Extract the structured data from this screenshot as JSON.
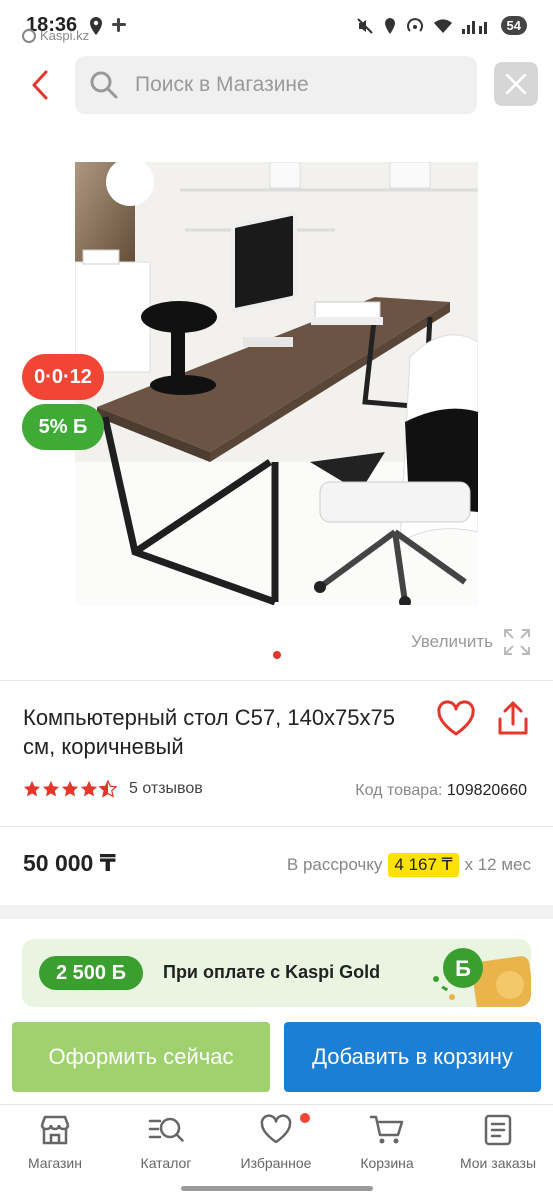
{
  "status_bar": {
    "time": "18:36",
    "app": "Kaspi.kz",
    "battery": "54"
  },
  "search": {
    "placeholder": "Поиск в Магазине"
  },
  "badges": {
    "installment": "0·0·12",
    "bonus": "5% Б"
  },
  "gallery": {
    "zoom_label": "Увеличить"
  },
  "product": {
    "title": "Компьютерный стол С57, 140х75х75 см, коричневый",
    "rating": 4.5,
    "reviews": "5 отзывов",
    "code_label": "Код товара:",
    "code_value": "109820660",
    "price": "50 000 ₸",
    "installment_prefix": "В рассрочку",
    "installment_amount": "4 167 ₸",
    "installment_suffix": "х 12 мес"
  },
  "kaspi_gold": {
    "bonus": "2 500 Б",
    "text": "При оплате с Kaspi Gold"
  },
  "actions": {
    "checkout": "Оформить сейчас",
    "add_to_cart": "Добавить в корзину"
  },
  "bottom_nav": {
    "shop": "Магазин",
    "catalog": "Каталог",
    "favorites": "Избранное",
    "cart": "Корзина",
    "orders": "Мои заказы"
  },
  "colors": {
    "accent_red": "#f14635",
    "bonus_green": "#3faa36",
    "checkout_green": "#9fd16f",
    "cart_blue": "#1a7fd5",
    "installment_yellow": "#ffe200"
  }
}
